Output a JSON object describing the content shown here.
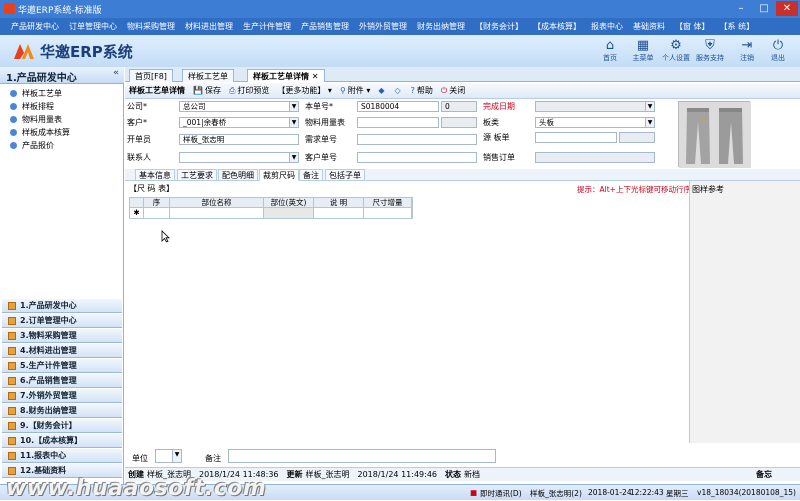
{
  "window": {
    "title": "华邀ERP系统-标准版"
  },
  "menu": [
    "产品研发中心",
    "订单管理中心",
    "物料采购管理",
    "材料进出管理",
    "生产计件管理",
    "产品销售管理",
    "外销外贸管理",
    "财务出纳管理",
    "【财务会计】",
    "【成本核算】",
    "报表中心",
    "基础资料",
    "【窗 体】",
    "【系 统】"
  ],
  "header": {
    "brand": "华邀ERP系统",
    "buttons": [
      {
        "label": "首页",
        "icon": "home-icon",
        "glyph": "⌂"
      },
      {
        "label": "主菜单",
        "icon": "menu-grid-icon",
        "glyph": "▦"
      },
      {
        "label": "个人设置",
        "icon": "gear-icon",
        "glyph": "⚙"
      },
      {
        "label": "服务支持",
        "icon": "support-icon",
        "glyph": "⛨"
      },
      {
        "label": "注销",
        "icon": "logout-icon",
        "glyph": "⇥"
      },
      {
        "label": "退出",
        "icon": "power-icon",
        "glyph": "⏻"
      }
    ]
  },
  "sidebar": {
    "title": "1.产品研发中心",
    "collapse_glyph": "«",
    "subitems": [
      "样板工艺单",
      "样板排程",
      "物料用量表",
      "样板成本核算",
      "产品报价"
    ],
    "nav": [
      "1.产品研发中心",
      "2.订单管理中心",
      "3.物料采购管理",
      "4.材料进出管理",
      "5.生产计件管理",
      "6.产品销售管理",
      "7.外销外贸管理",
      "8.财务出纳管理",
      "9.【财务会计】",
      "10.【成本核算】",
      "11.报表中心",
      "12.基础资料"
    ]
  },
  "tabs": [
    "首页[F8]",
    "样板工艺单",
    "样板工艺单详情"
  ],
  "tab_close": "✕",
  "toolbar": [
    {
      "label": "样板工艺单详情",
      "glyph": ""
    },
    {
      "label": "保存",
      "glyph": "💾"
    },
    {
      "label": "打印预览",
      "glyph": "⎙"
    },
    {
      "label": "【更多功能】 ▾",
      "glyph": ""
    },
    {
      "label": "附件 ▾",
      "glyph": "⚲"
    },
    {
      "label": "",
      "glyph": "◆"
    },
    {
      "label": "",
      "glyph": "◇"
    },
    {
      "label": "帮助",
      "glyph": "?"
    },
    {
      "label": "关闭",
      "glyph": "⏻"
    }
  ],
  "form": {
    "company_label": "公司*",
    "company_value": "总公司",
    "customer_label": "客户*",
    "customer_value": "_001|余春桥",
    "maker_label": "开单员",
    "maker_value": "样板_张志明",
    "contact_label": "联系人",
    "contact_value": "",
    "bill_no_label": "本单号*",
    "bill_no_value": "S0180004",
    "bill_seq": "0",
    "material_label": "物料用量表",
    "material_value": "",
    "demand_label": "需求单号",
    "demand_value": "",
    "cust_no_label": "客户单号",
    "cust_no_value": "",
    "finish_label": "完成日期",
    "finish_value": "",
    "type_label": "板类",
    "type_value": "头板",
    "source_label": "源 板单",
    "source_value": "",
    "sales_label": "销售订单",
    "sales_value": ""
  },
  "subtabs": [
    "基本信息",
    "工艺要求",
    "配色明细",
    "裁剪尺码",
    "备注",
    "包括子单"
  ],
  "grid": {
    "title": "【尺 码 表】",
    "hint": "提示：Alt+上下光标键可移动行序",
    "columns": [
      "序",
      "部位名称",
      "部位(英文)",
      "说 明",
      "尺寸增量"
    ],
    "new_row_glyph": "✱"
  },
  "ref_panel": {
    "title": "图样参考"
  },
  "bottom": {
    "unit_label": "单位",
    "remark_label": "备注"
  },
  "info": {
    "create_label": "创建",
    "creator": "样板_张志明",
    "create_time": "2018/1/24 11:48:36",
    "update_label": "更新",
    "updater": "样板_张志明",
    "update_time": "2018/1/24 11:49:46",
    "status_label": "状态",
    "status": "新档",
    "remark_right": "备忘"
  },
  "statusbar": {
    "chat": "即时通讯(D)",
    "user": "样板_张志明(2)",
    "date": "2018-01-24",
    "time": "12:22:43",
    "weekday": "星期三",
    "version": "v18_18034(20180108_15)"
  },
  "watermark": "www.huaaosoft.com"
}
